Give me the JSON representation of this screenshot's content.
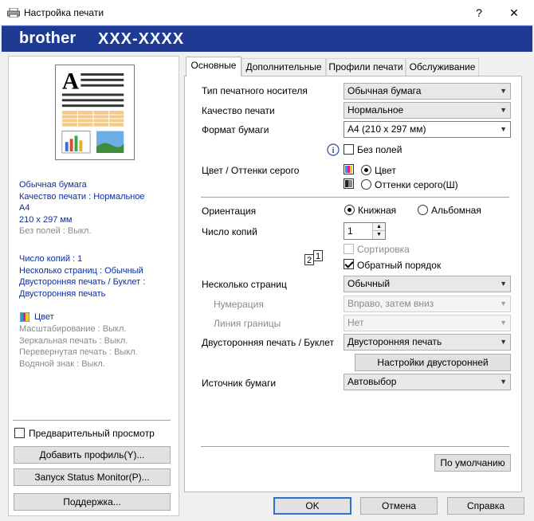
{
  "window": {
    "title": "Настройка печати",
    "help_button": "?",
    "close_button": "✕"
  },
  "banner": {
    "brand": "brother",
    "model": "XXX-XXXX"
  },
  "left_panel": {
    "summary_blue": [
      "Обычная бумага",
      "Качество печати : Нормальное",
      "A4",
      "210 x 297 мм"
    ],
    "summary_gray_1": "Без полей : Выкл.",
    "summary_blue_2": [
      "Число копий : 1",
      "Несколько страниц : Обычный",
      "Двусторонняя печать / Буклет :",
      "Двусторонняя печать"
    ],
    "color_label": "Цвет",
    "summary_gray_2": [
      "Масштабирование : Выкл.",
      "Зеркальная печать : Выкл.",
      "Перевернутая печать : Выкл.",
      "Водяной знак : Выкл."
    ],
    "preview_checkbox": "Предварительный просмотр",
    "add_profile_button": "Добавить профиль(Y)...",
    "status_monitor_button": "Запуск Status Monitor(P)...",
    "support_button": "Поддержка..."
  },
  "tabs": [
    "Основные",
    "Дополнительные",
    "Профили печати",
    "Обслуживание"
  ],
  "form": {
    "media_type_label": "Тип печатного носителя",
    "media_type_value": "Обычная бумага",
    "quality_label": "Качество печати",
    "quality_value": "Нормальное",
    "paper_size_label": "Формат бумаги",
    "paper_size_value": "A4 (210 x 297 мм)",
    "borderless_label": "Без полей",
    "color_mode_label": "Цвет / Оттенки серого",
    "color_option": "Цвет",
    "grayscale_option": "Оттенки серого(Ш)",
    "orientation_label": "Ориентация",
    "portrait_option": "Книжная",
    "landscape_option": "Альбомная",
    "copies_label": "Число копий",
    "copies_value": "1",
    "collate_label": "Сортировка",
    "reverse_order_label": "Обратный порядок",
    "multiple_pages_label": "Несколько страниц",
    "multiple_pages_value": "Обычный",
    "page_order_label": "Нумерация",
    "page_order_value": "Вправо, затем вниз",
    "border_line_label": "Линия границы",
    "border_line_value": "Нет",
    "duplex_label": "Двусторонняя печать / Буклет",
    "duplex_value": "Двусторонняя печать",
    "duplex_settings_button": "Настройки двусторонней печати(Щ)...",
    "paper_source_label": "Источник бумаги",
    "paper_source_value": "Автовыбор",
    "default_button": "По умолчанию"
  },
  "footer": {
    "ok_button": "OK",
    "cancel_button": "Отмена",
    "help_button": "Справка"
  }
}
